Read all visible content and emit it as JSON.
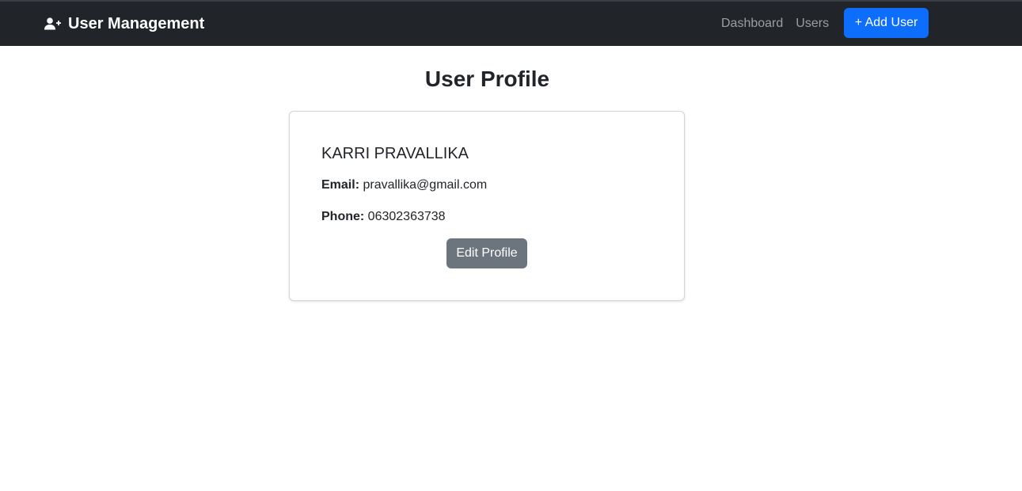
{
  "navbar": {
    "brand": {
      "icon": "user-plus-icon",
      "label": "User Management"
    },
    "links": [
      {
        "label": "Dashboard"
      },
      {
        "label": "Users"
      }
    ],
    "add_button": {
      "label": "+ Add User",
      "color": "#0d6efd"
    },
    "background": "#212529"
  },
  "main": {
    "title": "User Profile",
    "profile": {
      "name": "KARRI PRAVALLIKA",
      "email_label": "Email:",
      "email": "pravallika@gmail.com",
      "phone_label": "Phone:",
      "phone": "06302363738",
      "edit_button": {
        "label": "Edit Profile",
        "color": "#6c757d"
      }
    }
  }
}
